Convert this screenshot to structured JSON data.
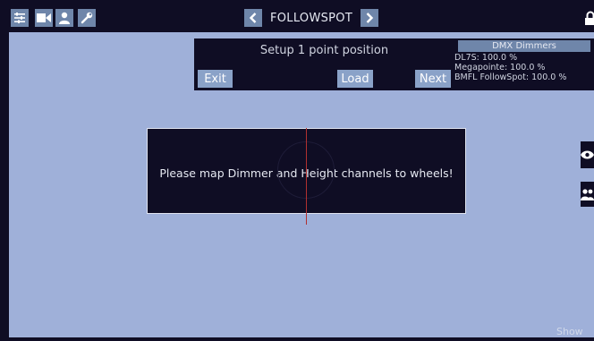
{
  "colors": {
    "background": "#9fb0d9",
    "panel": "#0f0d24",
    "button": "#8aa2c8",
    "icon_button": "#6f86aa",
    "crosshair": "#b03030"
  },
  "toolbar": {
    "icons": [
      "sliders-icon",
      "video-camera-icon",
      "user-icon",
      "wrench-icon"
    ],
    "title": "FOLLOWSPOT",
    "right_icon": "lock-icon"
  },
  "setup": {
    "title": "Setup 1 point position",
    "buttons": {
      "exit": "Exit",
      "load": "Load",
      "next": "Next"
    }
  },
  "dmx": {
    "title": "DMX Dimmers",
    "rows": [
      "DL7S: 100.0 %",
      "Megapointe: 100.0 %",
      "BMFL FollowSpot: 100.0 %"
    ]
  },
  "message": "Please map Dimmer and Height channels to wheels!",
  "side_tabs": [
    "eye-icon",
    "users-icon"
  ],
  "footer": {
    "show": "Show"
  }
}
